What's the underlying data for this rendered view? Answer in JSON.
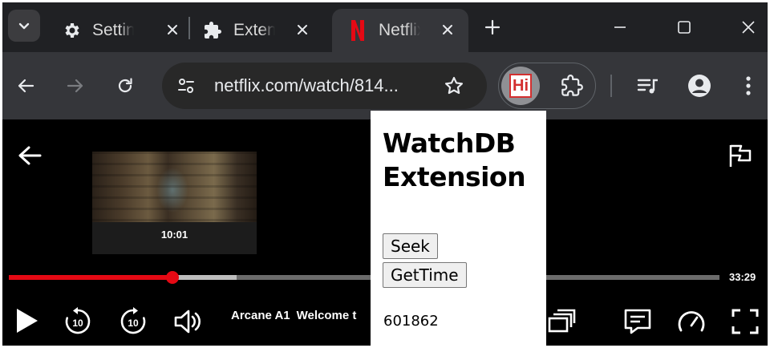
{
  "browser": {
    "tabs": [
      {
        "label": "Settings",
        "icon": "gear-icon"
      },
      {
        "label": "Extensions",
        "icon": "puzzle-icon"
      },
      {
        "label": "Netflix",
        "icon": "netflix-icon",
        "active": true
      }
    ],
    "address": {
      "url": "netflix.com/watch/814..."
    },
    "colors": {
      "tabstrip": "#202124",
      "toolbar": "#35363a",
      "netflix_red": "#e50914"
    }
  },
  "player": {
    "preview_time": "10:01",
    "duration": "33:29",
    "progress_fraction": 0.23,
    "buffered_fraction": 0.32,
    "title": "Arcane A1",
    "episode": "Welcome t"
  },
  "popup": {
    "title_line1": "WatchDB",
    "title_line2": "Extension",
    "seek_label": "Seek",
    "gettime_label": "GetTime",
    "time_value": "601862"
  }
}
